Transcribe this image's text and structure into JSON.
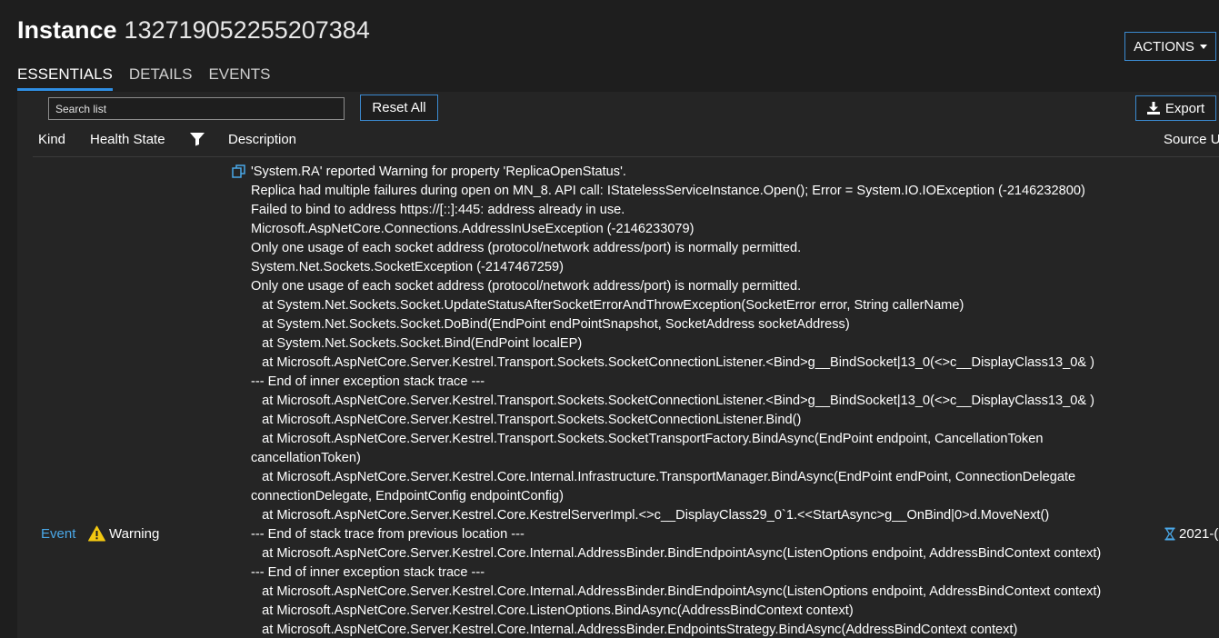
{
  "header": {
    "title_prefix": "Instance",
    "instance_id": "132719052255207384",
    "actions_label": "ACTIONS"
  },
  "tabs": [
    {
      "label": "ESSENTIALS",
      "active": true
    },
    {
      "label": "DETAILS",
      "active": false
    },
    {
      "label": "EVENTS",
      "active": false
    }
  ],
  "toolbar": {
    "search_placeholder": "Search list",
    "reset_label": "Reset All",
    "export_label": "Export"
  },
  "columns": {
    "kind": "Kind",
    "health_state": "Health State",
    "description": "Description",
    "source": "Source U"
  },
  "row": {
    "kind": "Event",
    "health_state": "Warning",
    "source_time": "2021-(",
    "description_first": "'System.RA' reported Warning for property 'ReplicaOpenStatus'.",
    "description_lines": [
      "Replica had multiple failures during open on MN_8. API call: IStatelessServiceInstance.Open(); Error = System.IO.IOException (-2146232800)",
      "Failed to bind to address https://[::]:445: address already in use.",
      "Microsoft.AspNetCore.Connections.AddressInUseException (-2146233079)",
      "Only one usage of each socket address (protocol/network address/port) is normally permitted.",
      "System.Net.Sockets.SocketException (-2147467259)",
      "Only one usage of each socket address (protocol/network address/port) is normally permitted.",
      "   at System.Net.Sockets.Socket.UpdateStatusAfterSocketErrorAndThrowException(SocketError error, String callerName)",
      "   at System.Net.Sockets.Socket.DoBind(EndPoint endPointSnapshot, SocketAddress socketAddress)",
      "   at System.Net.Sockets.Socket.Bind(EndPoint localEP)",
      "   at Microsoft.AspNetCore.Server.Kestrel.Transport.Sockets.SocketConnectionListener.<Bind>g__BindSocket|13_0(<>c__DisplayClass13_0& )",
      "--- End of inner exception stack trace ---",
      "   at Microsoft.AspNetCore.Server.Kestrel.Transport.Sockets.SocketConnectionListener.<Bind>g__BindSocket|13_0(<>c__DisplayClass13_0& )",
      "   at Microsoft.AspNetCore.Server.Kestrel.Transport.Sockets.SocketConnectionListener.Bind()",
      "   at Microsoft.AspNetCore.Server.Kestrel.Transport.Sockets.SocketTransportFactory.BindAsync(EndPoint endpoint, CancellationToken cancellationToken)",
      "   at Microsoft.AspNetCore.Server.Kestrel.Core.Internal.Infrastructure.TransportManager.BindAsync(EndPoint endPoint, ConnectionDelegate connectionDelegate, EndpointConfig endpointConfig)",
      "   at Microsoft.AspNetCore.Server.Kestrel.Core.KestrelServerImpl.<>c__DisplayClass29_0`1.<<StartAsync>g__OnBind|0>d.MoveNext()",
      "--- End of stack trace from previous location ---",
      "   at Microsoft.AspNetCore.Server.Kestrel.Core.Internal.AddressBinder.BindEndpointAsync(ListenOptions endpoint, AddressBindContext context)",
      "--- End of inner exception stack trace ---",
      "   at Microsoft.AspNetCore.Server.Kestrel.Core.Internal.AddressBinder.BindEndpointAsync(ListenOptions endpoint, AddressBindContext context)",
      "   at Microsoft.AspNetCore.Server.Kestrel.Core.ListenOptions.BindAsync(AddressBindContext context)",
      "   at Microsoft.AspNetCore.Server.Kestrel.Core.Internal.AddressBinder.EndpointsStrategy.BindAsync(AddressBindContext context)"
    ]
  },
  "colors": {
    "accent": "#2f8fe4",
    "link": "#4aa8e8",
    "warning": "#f2c811",
    "background": "#1e1e1e",
    "panel": "#252525"
  }
}
